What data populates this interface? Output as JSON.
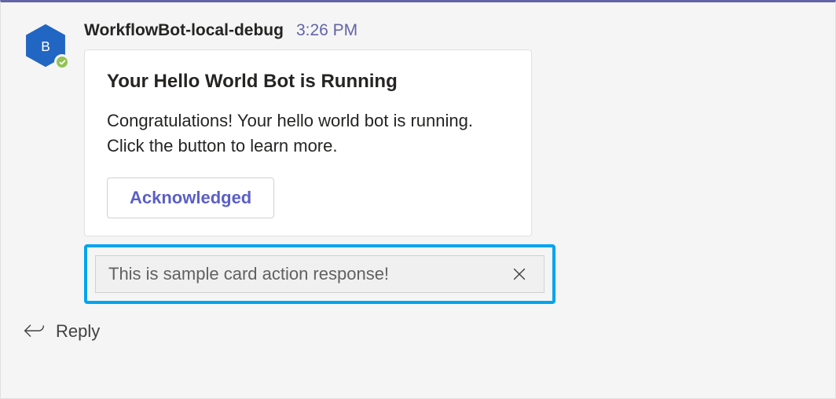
{
  "message": {
    "sender_name": "WorkflowBot-local-debug",
    "timestamp": "3:26 PM",
    "avatar_letter": "B",
    "avatar_color": "#2266c3",
    "presence": "available"
  },
  "card": {
    "title": "Your Hello World Bot is Running",
    "body": "Congratulations! Your hello world bot is running. Click the button to learn more.",
    "action_label": "Acknowledged"
  },
  "response_banner": {
    "text": "This is sample card action response!",
    "close_icon": "close-icon"
  },
  "reply": {
    "label": "Reply",
    "icon": "reply-icon"
  },
  "colors": {
    "accent": "#6264a7",
    "highlight_border": "#00a4ef",
    "button_text": "#5b5fc7"
  }
}
